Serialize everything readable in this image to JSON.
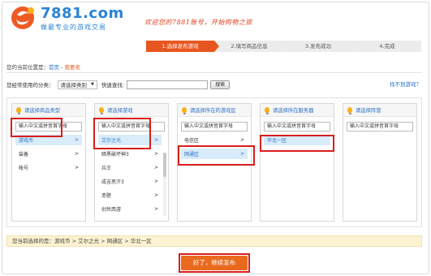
{
  "header": {
    "logo_name": "7881.com",
    "logo_slogan": "做最专业的游戏交易",
    "welcome": "欢迎您的7881账号，开始购物之旅"
  },
  "steps": [
    {
      "label": "1.选择发布游戏",
      "active": true
    },
    {
      "label": "2.填写商品信息",
      "active": false
    },
    {
      "label": "3.发布成功",
      "active": false
    },
    {
      "label": "4.完成",
      "active": false
    }
  ],
  "breadcrumb": {
    "prefix": "您的当前位置是：",
    "home": "首页",
    "sep": " - ",
    "current": "我要卖"
  },
  "category_row": {
    "label": "您经常使用的分类：",
    "select_value": "请选择类别",
    "quick_search_label": "快速查找:",
    "search_button": "搜索",
    "not_found_link": "找不到游戏？"
  },
  "columns": [
    {
      "header": "请选择商品类型",
      "search_placeholder": "输入中文或拼音首字母",
      "items": [
        {
          "label": "游戏币",
          "arrow": ">",
          "selected": true
        },
        {
          "label": "装备",
          "arrow": ">",
          "selected": false
        },
        {
          "label": "帐号",
          "arrow": ">",
          "selected": false
        }
      ]
    },
    {
      "header": "请选择游戏",
      "search_placeholder": "输入中文或拼音首字母",
      "items": [
        {
          "label": "艾尔之光",
          "arrow": ">",
          "selected": true
        },
        {
          "label": "暗黑破坏神3",
          "arrow": ">",
          "selected": false
        },
        {
          "label": "兵王",
          "arrow": ">",
          "selected": false
        },
        {
          "label": "成吉思汗3",
          "arrow": ">",
          "selected": false
        },
        {
          "label": "赤壁",
          "arrow": ">",
          "selected": false
        },
        {
          "label": "创世西游",
          "arrow": ">",
          "selected": false
        }
      ]
    },
    {
      "header": "请选择所在的游戏区",
      "search_placeholder": "输入中文或拼音首字母",
      "items": [
        {
          "label": "电信区",
          "arrow": ">",
          "selected": false
        },
        {
          "label": "网通区",
          "arrow": ">",
          "selected": true
        }
      ]
    },
    {
      "header": "请选择所在服务器",
      "search_placeholder": "输入中文或拼音首字母",
      "items": [
        {
          "label": "华北一区",
          "arrow": "",
          "selected": true
        }
      ]
    },
    {
      "header": "请选择阵营",
      "search_placeholder": "输入中文或拼音首字母",
      "items": []
    }
  ],
  "result": {
    "prefix": "您当前选择的是：",
    "path": "游戏币 > 艾尔之光 > 网通区 > 华北一区"
  },
  "submit_button": "好了，继续发布",
  "colors": {
    "accent": "#e8561f",
    "link": "#2a6fc2",
    "highlight": "#d81e1e",
    "selected_bg": "#d8ecfa"
  }
}
